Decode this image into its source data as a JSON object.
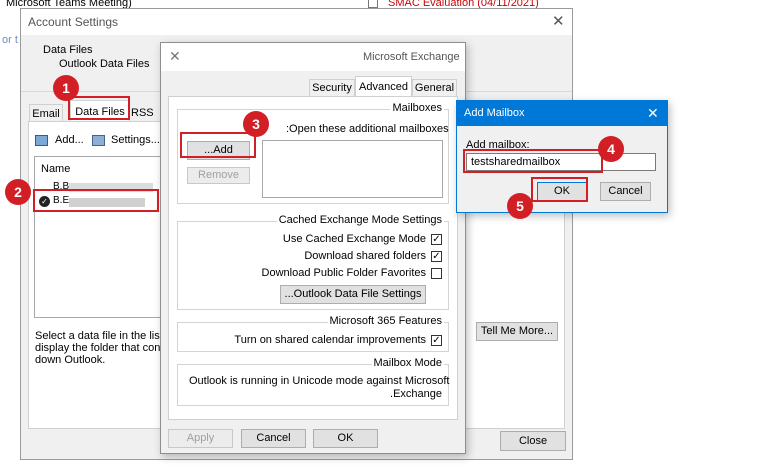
{
  "background_window": {
    "meeting_title": "Microsoft Teams Meeting)",
    "event_title": "SMAC Evaluation (04/11/2021)"
  },
  "left_edge_text": "or t",
  "account_settings": {
    "title": "Account Settings",
    "section_title": "Data Files",
    "section_subtitle": "Outlook Data Files",
    "tabs": [
      "Email",
      "Data Files",
      "RSS Fe"
    ],
    "toolbar": {
      "add": "Add...",
      "settings": "Settings..."
    },
    "list_header": "Name",
    "rows": [
      "B.B",
      "B.E...."
    ],
    "info_text": [
      "Select a data file in the list,",
      "display the folder that cont",
      "down Outlook."
    ],
    "tell_me_more": "Tell Me More...",
    "close": "Close"
  },
  "exchange_dialog": {
    "title": "Microsoft Exchange",
    "tabs": [
      "Security",
      "Advanced",
      "General"
    ],
    "mailboxes": {
      "legend": "Mailboxes",
      "label": ":Open these additional mailboxes",
      "add": "...Add",
      "remove": "Remove"
    },
    "cached": {
      "legend": "Cached Exchange Mode Settings",
      "options": [
        {
          "label": "Use Cached Exchange Mode",
          "checked": true
        },
        {
          "label": "Download shared folders",
          "checked": true
        },
        {
          "label": "Download Public Folder Favorites",
          "checked": false
        }
      ],
      "ost_settings": "...Outlook Data File Settings"
    },
    "m365": {
      "legend": "Microsoft 365 Features",
      "option": "Turn on shared calendar improvements",
      "checked": true
    },
    "mailbox_mode": {
      "legend": "Mailbox Mode",
      "text_line1": "Outlook is running in Unicode mode against Microsoft",
      "text_line2": ".Exchange"
    },
    "footer": {
      "apply": "Apply",
      "cancel": "Cancel",
      "ok": "OK"
    }
  },
  "add_mailbox_dialog": {
    "title": "Add Mailbox",
    "label": "Add mailbox:",
    "value": "testsharedmailbox",
    "ok": "OK",
    "cancel": "Cancel"
  },
  "markers": [
    "1",
    "2",
    "3",
    "4",
    "5"
  ],
  "colors": {
    "marker_red": "#d11f25",
    "title_blue": "#0078d7",
    "dialog_bg": "#f0f0f0"
  }
}
